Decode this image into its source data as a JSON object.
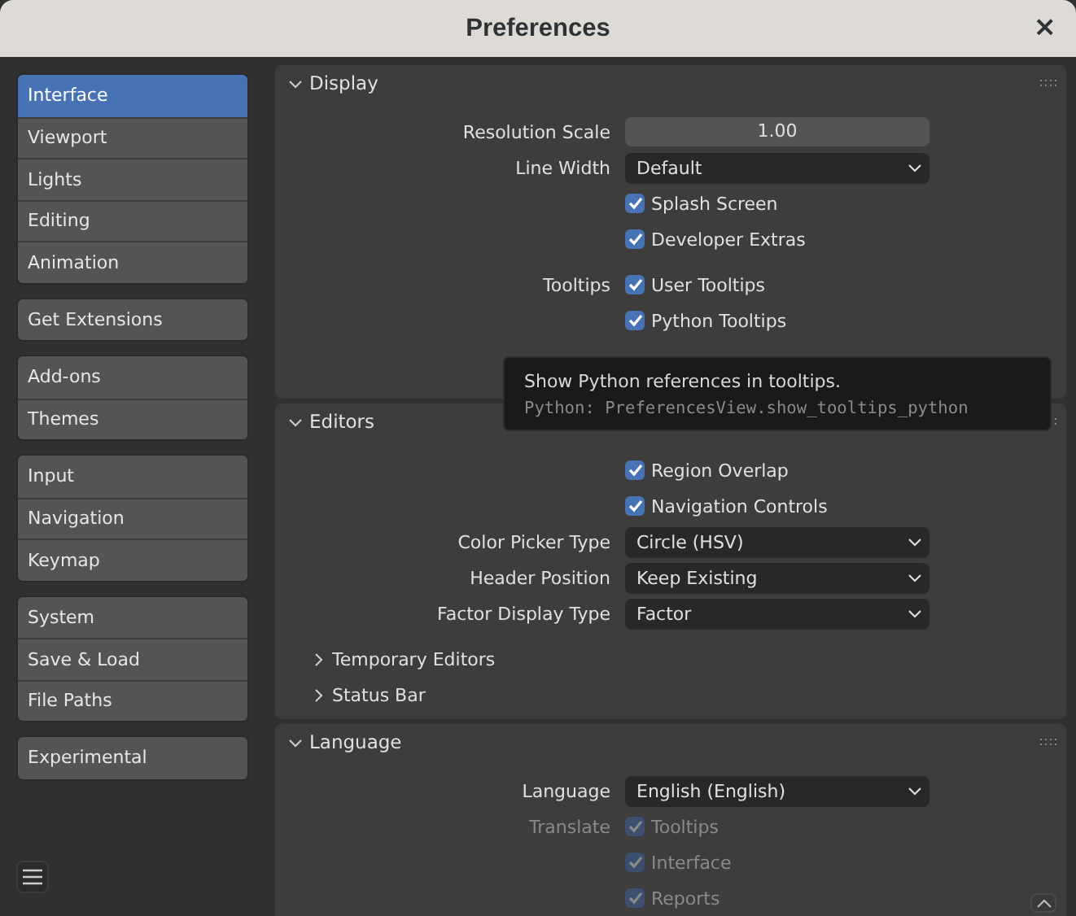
{
  "window": {
    "title": "Preferences",
    "close": "×"
  },
  "sidebar": {
    "groups": [
      [
        {
          "label": "Interface",
          "selected": true
        },
        {
          "label": "Viewport",
          "selected": false
        },
        {
          "label": "Lights",
          "selected": false
        },
        {
          "label": "Editing",
          "selected": false
        },
        {
          "label": "Animation",
          "selected": false
        }
      ],
      [
        {
          "label": "Get Extensions",
          "selected": false
        }
      ],
      [
        {
          "label": "Add-ons",
          "selected": false
        },
        {
          "label": "Themes",
          "selected": false
        }
      ],
      [
        {
          "label": "Input",
          "selected": false
        },
        {
          "label": "Navigation",
          "selected": false
        },
        {
          "label": "Keymap",
          "selected": false
        }
      ],
      [
        {
          "label": "System",
          "selected": false
        },
        {
          "label": "Save & Load",
          "selected": false
        },
        {
          "label": "File Paths",
          "selected": false
        }
      ],
      [
        {
          "label": "Experimental",
          "selected": false
        }
      ]
    ]
  },
  "panels": [
    {
      "title": "Display",
      "expanded": true,
      "rows": [
        {
          "kind": "number",
          "label": "Resolution Scale",
          "value": "1.00"
        },
        {
          "kind": "dropdown",
          "label": "Line Width",
          "value": "Default"
        },
        {
          "kind": "checkbox",
          "text": "Splash Screen",
          "checked": true,
          "disabled": false
        },
        {
          "kind": "checkbox",
          "text": "Developer Extras",
          "checked": true,
          "disabled": false
        },
        {
          "kind": "checkbox",
          "label": "Tooltips",
          "text": "User Tooltips",
          "checked": true,
          "disabled": false
        },
        {
          "kind": "checkbox",
          "text": "Python Tooltips",
          "checked": true,
          "disabled": false
        }
      ]
    },
    {
      "title": "Editors",
      "expanded": true,
      "rows": [
        {
          "kind": "checkbox",
          "text": "Region Overlap",
          "checked": true,
          "disabled": false
        },
        {
          "kind": "checkbox",
          "text": "Navigation Controls",
          "checked": true,
          "disabled": false
        },
        {
          "kind": "dropdown",
          "label": "Color Picker Type",
          "value": "Circle (HSV)"
        },
        {
          "kind": "dropdown",
          "label": "Header Position",
          "value": "Keep Existing"
        },
        {
          "kind": "dropdown",
          "label": "Factor Display Type",
          "value": "Factor"
        },
        {
          "kind": "subpanel",
          "text": "Temporary Editors",
          "expanded": false
        },
        {
          "kind": "subpanel",
          "text": "Status Bar",
          "expanded": false
        }
      ]
    },
    {
      "title": "Language",
      "expanded": true,
      "rows": [
        {
          "kind": "dropdown",
          "label": "Language",
          "value": "English (English)"
        },
        {
          "kind": "checkbox",
          "label": "Translate",
          "text": "Tooltips",
          "checked": true,
          "disabled": true
        },
        {
          "kind": "checkbox",
          "text": "Interface",
          "checked": true,
          "disabled": true
        },
        {
          "kind": "checkbox",
          "text": "Reports",
          "checked": true,
          "disabled": true
        }
      ]
    }
  ],
  "tooltip": {
    "text": "Show Python references in tooltips.",
    "python": "Python: PreferencesView.show_tooltips_python"
  }
}
